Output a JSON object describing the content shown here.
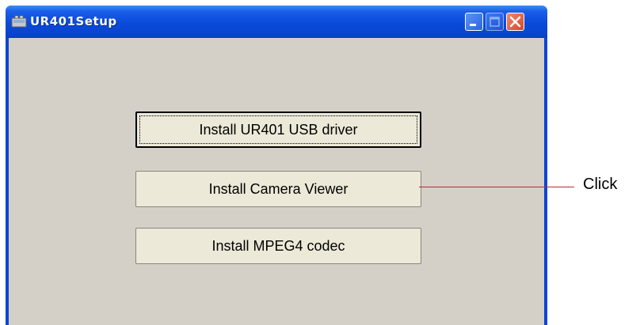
{
  "window": {
    "title": "UR401Setup"
  },
  "buttons": {
    "install_usb_driver": "Install UR401 USB driver",
    "install_camera_viewer": "Install Camera Viewer",
    "install_mpeg4_codec": "Install MPEG4 codec"
  },
  "callout": {
    "label": "Click"
  },
  "colors": {
    "titlebar": "#0a4ad9",
    "client_bg": "#d4d0c8",
    "button_bg": "#ece9d8",
    "close_button": "#d8452a",
    "callout_line": "#b03030"
  },
  "icons": [
    "app-icon",
    "minimize-icon",
    "maximize-icon",
    "close-icon"
  ]
}
